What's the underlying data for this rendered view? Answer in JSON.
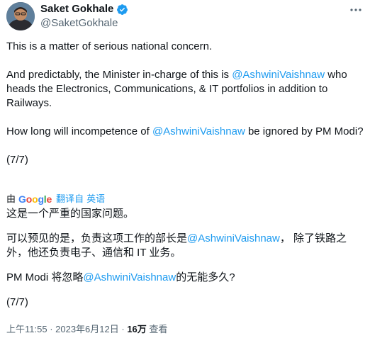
{
  "author": {
    "name": "Saket Gokhale",
    "handle": "@SaketGokhale"
  },
  "more_icon": "more-horizontal-icon",
  "tweet": {
    "line1": "This is a matter of serious national concern.",
    "line2_pre": "And predictably, the Minister in-charge of this is ",
    "mention": "@AshwiniVaishnaw",
    "line2_post": " who heads the Electronics, Communications, & IT portfolios in addition to Railways.",
    "line3_pre": "How long will incompetence of ",
    "line3_post": " be ignored by PM Modi?",
    "page": "(7/7)"
  },
  "translation": {
    "by": "由",
    "google": "Google",
    "translated_from": "翻译自",
    "language": "英语",
    "zh_line1": "这是一个严重的国家问题。",
    "zh_line2_pre": "可以预见的是，负责这项工作的部长是",
    "zh_line2_post": "， 除了铁路之外，他还负责电子、通信和 IT 业务。",
    "zh_line3_pre": "PM Modi 将忽略",
    "zh_line3_post": "的无能多久?",
    "page": "(7/7)"
  },
  "meta": {
    "time": "上午11:55",
    "sep1": " · ",
    "date": "2023年6月12日",
    "sep2": " · ",
    "views_count": "16万",
    "views_label": " 查看"
  },
  "colors": {
    "link": "#1d9bf0",
    "text": "#0f1419",
    "muted": "#536471",
    "verified": "#1d9bf0"
  }
}
